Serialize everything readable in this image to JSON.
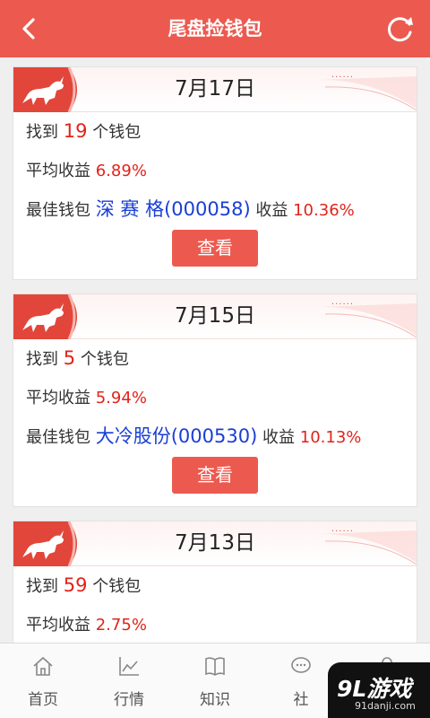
{
  "header": {
    "title": "尾盘捡钱包",
    "back_icon": "chevron-left-icon",
    "refresh_icon": "refresh-icon",
    "color": "#ec5a4f"
  },
  "cards": [
    {
      "date": "7月17日",
      "deco": "......",
      "found_prefix": "找到",
      "found_count": "19",
      "found_suffix": "个钱包",
      "avg_label": "平均收益",
      "avg_value": "6.89%",
      "best_label": "最佳钱包",
      "best_name": "深 赛 格(000058)",
      "best_return_label": "收益",
      "best_return": "10.36%",
      "view_label": "查看"
    },
    {
      "date": "7月15日",
      "deco": "......",
      "found_prefix": "找到",
      "found_count": "5",
      "found_suffix": "个钱包",
      "avg_label": "平均收益",
      "avg_value": "5.94%",
      "best_label": "最佳钱包",
      "best_name": "大冷股份(000530)",
      "best_return_label": "收益",
      "best_return": "10.13%",
      "view_label": "查看"
    },
    {
      "date": "7月13日",
      "deco": "......",
      "found_prefix": "找到",
      "found_count": "59",
      "found_suffix": "个钱包",
      "avg_label": "平均收益",
      "avg_value": "2.75%"
    }
  ],
  "tabs": [
    {
      "label": "首页",
      "icon": "home-icon"
    },
    {
      "label": "行情",
      "icon": "chart-icon"
    },
    {
      "label": "知识",
      "icon": "book-icon"
    },
    {
      "label": "社",
      "icon": "chat-icon"
    },
    {
      "label": "",
      "icon": "user-icon"
    }
  ],
  "watermark": {
    "text": "9L游戏",
    "sub": "91danji.com"
  }
}
